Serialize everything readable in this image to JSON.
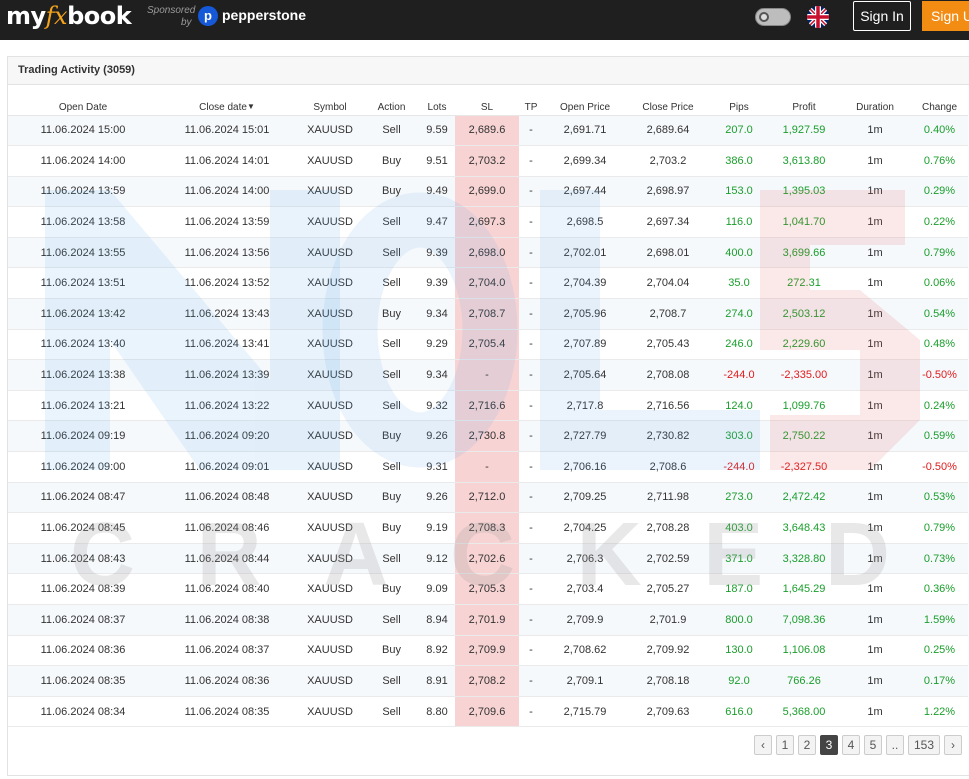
{
  "header": {
    "logo_my": "my",
    "logo_fx": "fx",
    "logo_book": "book",
    "sponsored": "Sponsored",
    "sponsored_by": "by",
    "sponsor_logo": "p",
    "sponsor_name": "pepperstone",
    "signin": "Sign In",
    "signup": "Sign Up"
  },
  "panel": {
    "title": "Trading Activity (3059)"
  },
  "columns": [
    "Open Date",
    "Close date",
    "Symbol",
    "Action",
    "Lots",
    "SL",
    "TP",
    "Open Price",
    "Close Price",
    "Pips",
    "Profit",
    "Duration",
    "Change"
  ],
  "sort_caret": "▼",
  "rows": [
    [
      "11.06.2024 15:00",
      "11.06.2024 15:01",
      "XAUUSD",
      "Sell",
      "9.59",
      "2,689.6",
      "-",
      "2,691.71",
      "2,689.64",
      "207.0",
      "1,927.59",
      "1m",
      "0.40%"
    ],
    [
      "11.06.2024 14:00",
      "11.06.2024 14:01",
      "XAUUSD",
      "Buy",
      "9.51",
      "2,703.2",
      "-",
      "2,699.34",
      "2,703.2",
      "386.0",
      "3,613.80",
      "1m",
      "0.76%"
    ],
    [
      "11.06.2024 13:59",
      "11.06.2024 14:00",
      "XAUUSD",
      "Buy",
      "9.49",
      "2,699.0",
      "-",
      "2,697.44",
      "2,698.97",
      "153.0",
      "1,395.03",
      "1m",
      "0.29%"
    ],
    [
      "11.06.2024 13:58",
      "11.06.2024 13:59",
      "XAUUSD",
      "Sell",
      "9.47",
      "2,697.3",
      "-",
      "2,698.5",
      "2,697.34",
      "116.0",
      "1,041.70",
      "1m",
      "0.22%"
    ],
    [
      "11.06.2024 13:55",
      "11.06.2024 13:56",
      "XAUUSD",
      "Sell",
      "9.39",
      "2,698.0",
      "-",
      "2,702.01",
      "2,698.01",
      "400.0",
      "3,699.66",
      "1m",
      "0.79%"
    ],
    [
      "11.06.2024 13:51",
      "11.06.2024 13:52",
      "XAUUSD",
      "Sell",
      "9.39",
      "2,704.0",
      "-",
      "2,704.39",
      "2,704.04",
      "35.0",
      "272.31",
      "1m",
      "0.06%"
    ],
    [
      "11.06.2024 13:42",
      "11.06.2024 13:43",
      "XAUUSD",
      "Buy",
      "9.34",
      "2,708.7",
      "-",
      "2,705.96",
      "2,708.7",
      "274.0",
      "2,503.12",
      "1m",
      "0.54%"
    ],
    [
      "11.06.2024 13:40",
      "11.06.2024 13:41",
      "XAUUSD",
      "Sell",
      "9.29",
      "2,705.4",
      "-",
      "2,707.89",
      "2,705.43",
      "246.0",
      "2,229.60",
      "1m",
      "0.48%"
    ],
    [
      "11.06.2024 13:38",
      "11.06.2024 13:39",
      "XAUUSD",
      "Sell",
      "9.34",
      "-",
      "-",
      "2,705.64",
      "2,708.08",
      "-244.0",
      "-2,335.00",
      "1m",
      "-0.50%"
    ],
    [
      "11.06.2024 13:21",
      "11.06.2024 13:22",
      "XAUUSD",
      "Sell",
      "9.32",
      "2,716.6",
      "-",
      "2,717.8",
      "2,716.56",
      "124.0",
      "1,099.76",
      "1m",
      "0.24%"
    ],
    [
      "11.06.2024 09:19",
      "11.06.2024 09:20",
      "XAUUSD",
      "Buy",
      "9.26",
      "2,730.8",
      "-",
      "2,727.79",
      "2,730.82",
      "303.0",
      "2,750.22",
      "1m",
      "0.59%"
    ],
    [
      "11.06.2024 09:00",
      "11.06.2024 09:01",
      "XAUUSD",
      "Sell",
      "9.31",
      "-",
      "-",
      "2,706.16",
      "2,708.6",
      "-244.0",
      "-2,327.50",
      "1m",
      "-0.50%"
    ],
    [
      "11.06.2024 08:47",
      "11.06.2024 08:48",
      "XAUUSD",
      "Buy",
      "9.26",
      "2,712.0",
      "-",
      "2,709.25",
      "2,711.98",
      "273.0",
      "2,472.42",
      "1m",
      "0.53%"
    ],
    [
      "11.06.2024 08:45",
      "11.06.2024 08:46",
      "XAUUSD",
      "Buy",
      "9.19",
      "2,708.3",
      "-",
      "2,704.25",
      "2,708.28",
      "403.0",
      "3,648.43",
      "1m",
      "0.79%"
    ],
    [
      "11.06.2024 08:43",
      "11.06.2024 08:44",
      "XAUUSD",
      "Sell",
      "9.12",
      "2,702.6",
      "-",
      "2,706.3",
      "2,702.59",
      "371.0",
      "3,328.80",
      "1m",
      "0.73%"
    ],
    [
      "11.06.2024 08:39",
      "11.06.2024 08:40",
      "XAUUSD",
      "Buy",
      "9.09",
      "2,705.3",
      "-",
      "2,703.4",
      "2,705.27",
      "187.0",
      "1,645.29",
      "1m",
      "0.36%"
    ],
    [
      "11.06.2024 08:37",
      "11.06.2024 08:38",
      "XAUUSD",
      "Sell",
      "8.94",
      "2,701.9",
      "-",
      "2,709.9",
      "2,701.9",
      "800.0",
      "7,098.36",
      "1m",
      "1.59%"
    ],
    [
      "11.06.2024 08:36",
      "11.06.2024 08:37",
      "XAUUSD",
      "Buy",
      "8.92",
      "2,709.9",
      "-",
      "2,708.62",
      "2,709.92",
      "130.0",
      "1,106.08",
      "1m",
      "0.25%"
    ],
    [
      "11.06.2024 08:35",
      "11.06.2024 08:36",
      "XAUUSD",
      "Sell",
      "8.91",
      "2,708.2",
      "-",
      "2,709.1",
      "2,708.18",
      "92.0",
      "766.26",
      "1m",
      "0.17%"
    ],
    [
      "11.06.2024 08:34",
      "11.06.2024 08:35",
      "XAUUSD",
      "Sell",
      "8.80",
      "2,709.6",
      "-",
      "2,715.79",
      "2,709.63",
      "616.0",
      "5,368.00",
      "1m",
      "1.22%"
    ]
  ],
  "pagination": {
    "prev_icon": "chevron-left-icon",
    "next_icon": "chevron-right-icon",
    "pages": [
      "1",
      "2",
      "3",
      "4",
      "5",
      "..",
      "153"
    ],
    "active": "3"
  },
  "watermark": {
    "big": "MQL5",
    "sub": "CRACKED"
  },
  "colors": {
    "positive": "#1a9e2c",
    "negative": "#e11b1b",
    "sl_highlight": "#f8d3d3",
    "accent": "#f28c13"
  }
}
